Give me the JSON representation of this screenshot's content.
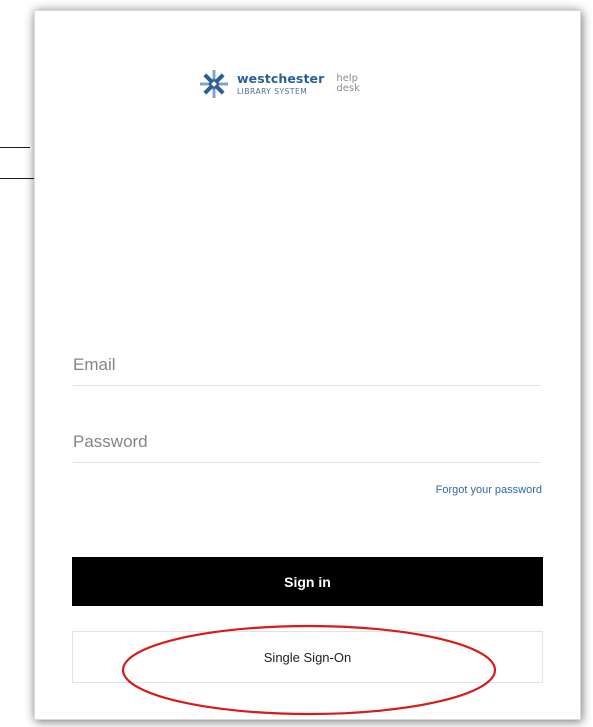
{
  "logo": {
    "name": "westchester",
    "subtitle": "LIBRARY SYSTEM",
    "help_line1": "help",
    "help_line2": "desk",
    "brand_color": "#2c5f97",
    "accent_color": "#7fa4d0"
  },
  "form": {
    "email_placeholder": "Email",
    "password_placeholder": "Password",
    "forgot_link": "Forgot your password",
    "sign_in_label": "Sign in",
    "sso_label": "Single Sign-On"
  },
  "annotation": {
    "shape": "ellipse",
    "color": "#d81a1a",
    "target": "single-sign-on-button"
  }
}
